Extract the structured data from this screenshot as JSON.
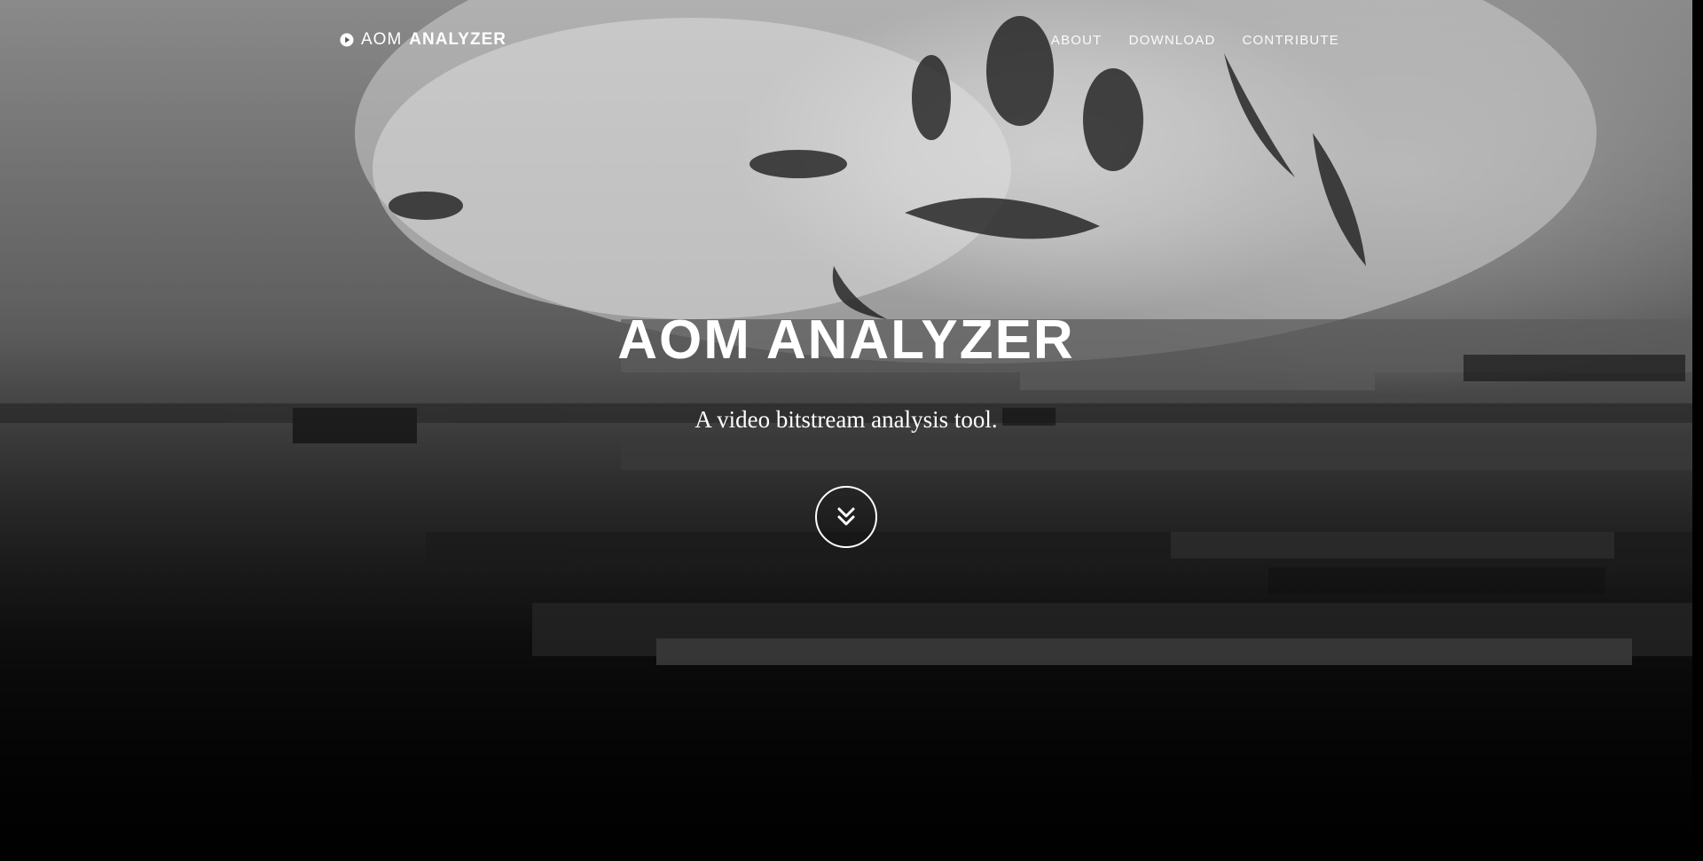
{
  "nav": {
    "brand_light": "AOM",
    "brand_bold": "ANALYZER",
    "brand_icon": "play-circle-icon",
    "items": [
      {
        "label": "ABOUT"
      },
      {
        "label": "DOWNLOAD"
      },
      {
        "label": "CONTRIBUTE"
      }
    ]
  },
  "hero": {
    "title": "AOM ANALYZER",
    "subtitle": "A video bitstream analysis tool.",
    "scroll_icon": "double-chevron-down-icon"
  },
  "colors": {
    "text": "#ffffff",
    "background": "#000000"
  }
}
